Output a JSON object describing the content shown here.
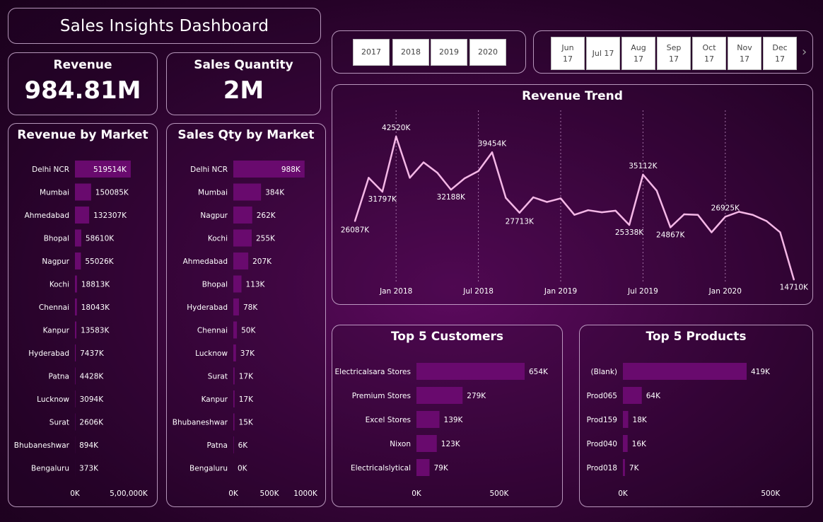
{
  "dashboard": {
    "title": "Sales Insights Dashboard"
  },
  "kpis": {
    "revenue_label": "Revenue",
    "revenue_value": "984.81M",
    "qty_label": "Sales Quantity",
    "qty_value": "2M"
  },
  "year_slicer": [
    "2017",
    "2018",
    "2019",
    "2020"
  ],
  "month_slicer": [
    {
      "m": "Jun",
      "y": "17"
    },
    {
      "m": "Jul",
      "y": "17"
    },
    {
      "m": "Aug",
      "y": "17"
    },
    {
      "m": "Sep",
      "y": "17"
    },
    {
      "m": "Oct",
      "y": "17"
    },
    {
      "m": "Nov",
      "y": "17"
    },
    {
      "m": "Dec",
      "y": "17"
    }
  ],
  "icons": {
    "month_next": "chevron-right-icon"
  },
  "colors": {
    "bar": "#690a6e",
    "line": "#f4b7e6",
    "gridline": "#a070a4"
  },
  "chart_data": [
    {
      "id": "revenue_by_market",
      "type": "bar",
      "orientation": "horizontal",
      "title": "Revenue by Market",
      "categories": [
        "Delhi NCR",
        "Mumbai",
        "Ahmedabad",
        "Bhopal",
        "Nagpur",
        "Kochi",
        "Chennai",
        "Kanpur",
        "Hyderabad",
        "Patna",
        "Lucknow",
        "Surat",
        "Bhubaneshwar",
        "Bengaluru"
      ],
      "values": [
        519514,
        150085,
        132307,
        58610,
        55026,
        18813,
        18043,
        13583,
        7437,
        4428,
        3094,
        2606,
        894,
        373
      ],
      "labels": [
        "519514K",
        "150085K",
        "132307K",
        "58610K",
        "55026K",
        "18813K",
        "18043K",
        "13583K",
        "7437K",
        "4428K",
        "3094K",
        "2606K",
        "894K",
        "373K"
      ],
      "xlim": [
        0,
        520000
      ],
      "ticks": [
        {
          "value": 0,
          "label": "0K"
        },
        {
          "value": 500000,
          "label": "5,00,000K"
        }
      ]
    },
    {
      "id": "sales_qty_by_market",
      "type": "bar",
      "orientation": "horizontal",
      "title": "Sales Qty by Market",
      "categories": [
        "Delhi NCR",
        "Mumbai",
        "Nagpur",
        "Kochi",
        "Ahmedabad",
        "Bhopal",
        "Hyderabad",
        "Chennai",
        "Lucknow",
        "Surat",
        "Kanpur",
        "Bhubaneshwar",
        "Patna",
        "Bengaluru"
      ],
      "values": [
        988,
        384,
        262,
        255,
        207,
        113,
        78,
        50,
        37,
        17,
        17,
        15,
        6,
        0
      ],
      "labels": [
        "988K",
        "384K",
        "262K",
        "255K",
        "207K",
        "113K",
        "78K",
        "50K",
        "37K",
        "17K",
        "17K",
        "15K",
        "6K",
        "0K"
      ],
      "xlim": [
        0,
        1000
      ],
      "ticks": [
        {
          "value": 0,
          "label": "0K"
        },
        {
          "value": 500,
          "label": "500K"
        },
        {
          "value": 1000,
          "label": "1000K"
        }
      ]
    },
    {
      "id": "revenue_trend",
      "type": "line",
      "title": "Revenue Trend",
      "x": [
        "2017-10",
        "2017-11",
        "2017-12",
        "2018-01",
        "2018-02",
        "2018-03",
        "2018-04",
        "2018-05",
        "2018-06",
        "2018-07",
        "2018-08",
        "2018-09",
        "2018-10",
        "2018-11",
        "2018-12",
        "2019-01",
        "2019-02",
        "2019-03",
        "2019-04",
        "2019-05",
        "2019-06",
        "2019-07",
        "2019-08",
        "2019-09",
        "2019-10",
        "2019-11",
        "2019-12",
        "2020-01",
        "2020-02",
        "2020-03",
        "2020-04",
        "2020-05",
        "2020-06"
      ],
      "values": [
        26087,
        34500,
        31797,
        42520,
        34500,
        37500,
        35500,
        32188,
        34400,
        35800,
        39454,
        30600,
        27713,
        30700,
        29800,
        30500,
        27300,
        28200,
        27800,
        28100,
        25338,
        35112,
        32000,
        24867,
        27400,
        27300,
        23900,
        26925,
        27900,
        27300,
        26100,
        23900,
        14710
      ],
      "point_labels": [
        {
          "index": 0,
          "label": "26087K"
        },
        {
          "index": 2,
          "label": "31797K"
        },
        {
          "index": 3,
          "label": "42520K"
        },
        {
          "index": 7,
          "label": "32188K"
        },
        {
          "index": 10,
          "label": "39454K"
        },
        {
          "index": 12,
          "label": "27713K"
        },
        {
          "index": 20,
          "label": "25338K"
        },
        {
          "index": 21,
          "label": "35112K"
        },
        {
          "index": 23,
          "label": "24867K"
        },
        {
          "index": 27,
          "label": "26925K"
        },
        {
          "index": 32,
          "label": "14710K"
        }
      ],
      "ylim": [
        12000,
        45000
      ],
      "x_ticks": [
        {
          "index": 3,
          "label": "Jan 2018"
        },
        {
          "index": 9,
          "label": "Jul 2018"
        },
        {
          "index": 15,
          "label": "Jan 2019"
        },
        {
          "index": 21,
          "label": "Jul 2019"
        },
        {
          "index": 27,
          "label": "Jan 2020"
        }
      ]
    },
    {
      "id": "top_5_customers",
      "type": "bar",
      "orientation": "horizontal",
      "title": "Top 5 Customers",
      "categories": [
        "Electricalsara Stores",
        "Premium Stores",
        "Excel Stores",
        "Nixon",
        "Electricalslytical"
      ],
      "values": [
        654,
        279,
        139,
        123,
        79
      ],
      "labels": [
        "654K",
        "279K",
        "139K",
        "123K",
        "79K"
      ],
      "xlim": [
        0,
        654
      ],
      "ticks": [
        {
          "value": 0,
          "label": "0K"
        },
        {
          "value": 500,
          "label": "500K"
        }
      ]
    },
    {
      "id": "top_5_products",
      "type": "bar",
      "orientation": "horizontal",
      "title": "Top 5 Products",
      "categories": [
        "(Blank)",
        "Prod065",
        "Prod159",
        "Prod040",
        "Prod018"
      ],
      "values": [
        419,
        64,
        18,
        16,
        7
      ],
      "labels": [
        "419K",
        "64K",
        "18K",
        "16K",
        "7K"
      ],
      "xlim": [
        0,
        419
      ],
      "ticks": [
        {
          "value": 0,
          "label": "0K"
        },
        {
          "value": 500,
          "label": "500K"
        }
      ]
    }
  ]
}
